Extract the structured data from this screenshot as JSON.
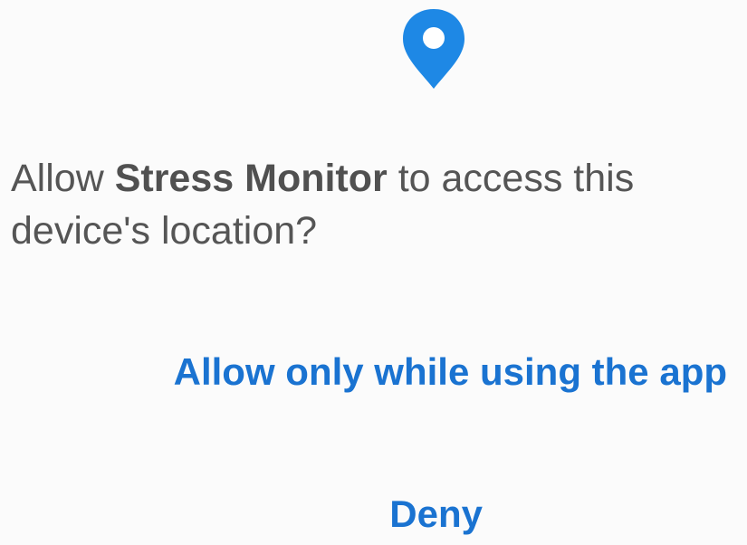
{
  "dialog": {
    "icon": "location-pin-icon",
    "accent_color": "#1e88e5",
    "message": {
      "prefix": "Allow ",
      "app_name": "Stress Monitor",
      "suffix": " to access this device's location?"
    },
    "buttons": {
      "allow_label": "Allow only while using the app",
      "deny_label": "Deny"
    }
  }
}
